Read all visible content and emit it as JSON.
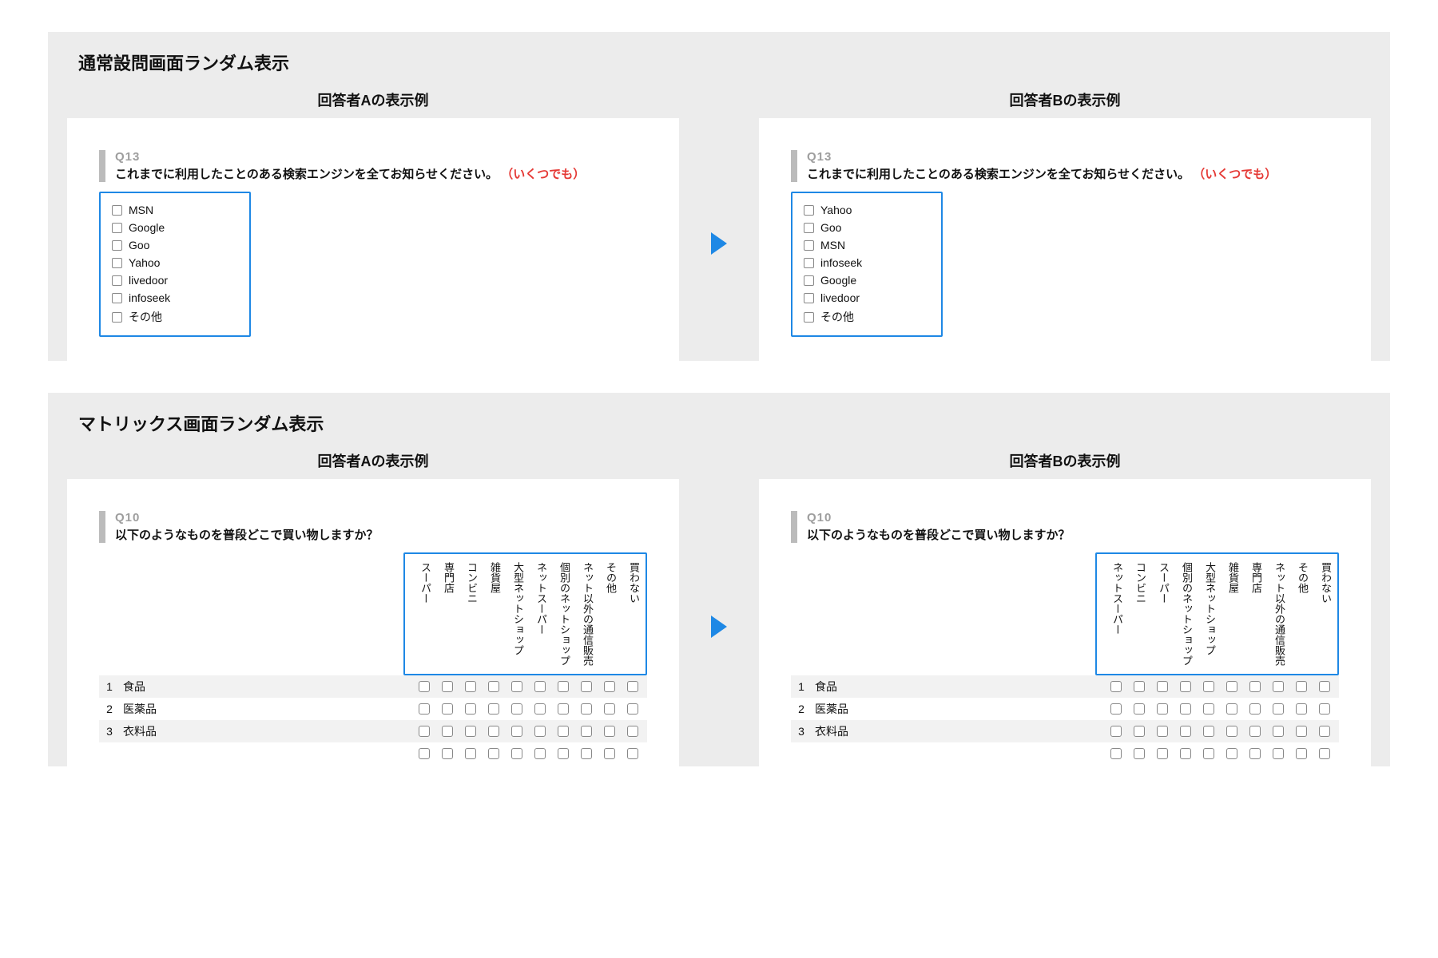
{
  "section1": {
    "title": "通常設問画面ランダム表示",
    "colA_title": "回答者Aの表示例",
    "colB_title": "回答者Bの表示例",
    "qnum": "Q13",
    "qtext_main": "これまでに利用したことのある検索エンジンを全てお知らせください。",
    "qtext_note": "（いくつでも）",
    "options_A": [
      "MSN",
      "Google",
      "Goo",
      "Yahoo",
      "livedoor",
      "infoseek",
      "その他"
    ],
    "options_B": [
      "Yahoo",
      "Goo",
      "MSN",
      "infoseek",
      "Google",
      "livedoor",
      "その他"
    ]
  },
  "section2": {
    "title": "マトリックス画面ランダム表示",
    "colA_title": "回答者Aの表示例",
    "colB_title": "回答者Bの表示例",
    "qnum": "Q10",
    "qtext": "以下のようなものを普段どこで買い物しますか？",
    "cols_A": [
      "スーパー",
      "専門店",
      "コンビニ",
      "雑貨屋",
      "大型ネットショップ",
      "ネットスーパー",
      "個別のネットショップ",
      "ネット以外の通信販売",
      "その他",
      "買わない"
    ],
    "cols_B": [
      "ネットスーパー",
      "コンビニ",
      "スーパー",
      "個別のネットショップ",
      "大型ネットショップ",
      "雑貨屋",
      "専門店",
      "ネット以外の通信販売",
      "その他",
      "買わない"
    ],
    "rows": [
      {
        "num": "1",
        "label": "食品"
      },
      {
        "num": "2",
        "label": "医薬品"
      },
      {
        "num": "3",
        "label": "衣料品"
      }
    ]
  }
}
